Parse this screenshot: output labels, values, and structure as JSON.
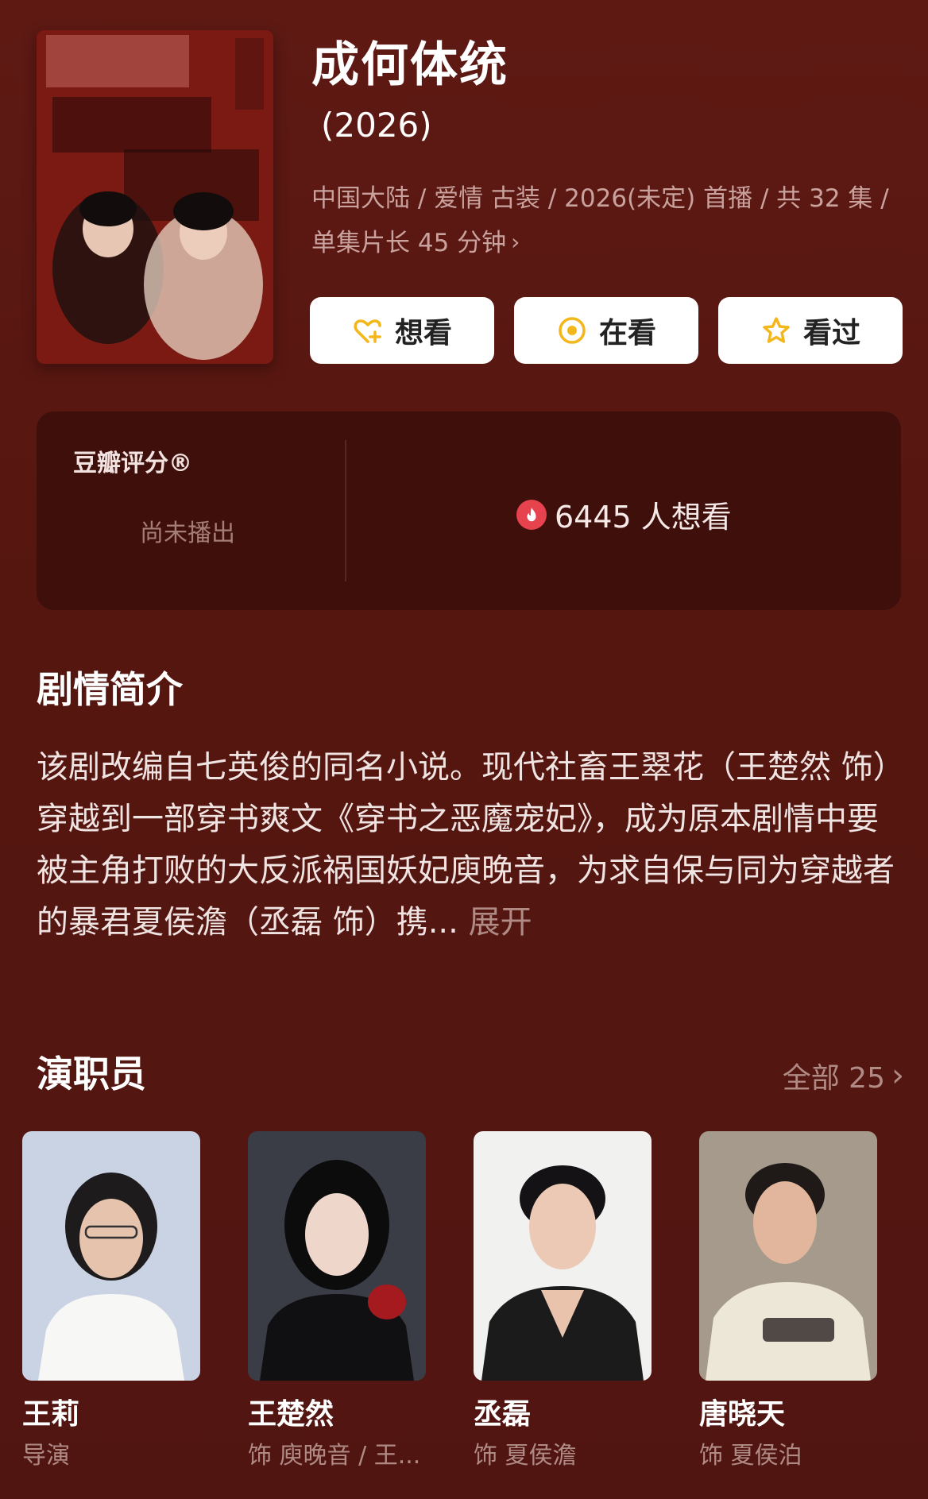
{
  "header": {
    "title": "成何体统",
    "year": "(2026)",
    "meta_line1": "中国大陆 / 爱情 古装 / 2026(未定) 首播 / 共 32 集 /",
    "meta_line2": "单集片长 45 分钟",
    "meta_chevron": "›"
  },
  "actions": [
    {
      "label": "想看",
      "icon": "heart-plus-icon",
      "color": "#f3b71c"
    },
    {
      "label": "在看",
      "icon": "target-icon",
      "color": "#f3b71c"
    },
    {
      "label": "看过",
      "icon": "star-icon",
      "color": "#f3b71c"
    }
  ],
  "rating": {
    "label": "豆瓣评分®",
    "status": "尚未播出",
    "want_count": "6445 人想看"
  },
  "synopsis": {
    "title": "剧情简介",
    "text": "该剧改编自七英俊的同名小说。现代社畜王翠花（王楚然 饰）穿越到一部穿书爽文《穿书之恶魔宠妃》，成为原本剧情中要被主角打败的大反派祸国妖妃庾晚音，为求自保与同为穿越者的暴君夏侯澹（丞磊 饰）携...",
    "more": "展开"
  },
  "cast": {
    "title": "演职员",
    "all_label": "全部 25",
    "all_chevron": "›",
    "members": [
      {
        "name": "王莉",
        "role": "导演"
      },
      {
        "name": "王楚然",
        "role": "饰 庾晚音 / 王..."
      },
      {
        "name": "丞磊",
        "role": "饰 夏侯澹"
      },
      {
        "name": "唐晓天",
        "role": "饰 夏侯泊"
      }
    ]
  },
  "colors": {
    "background": "#5a1812",
    "card": "#3f0f0b",
    "accent": "#f3b71c",
    "muted_text": "#b08b86",
    "flame": "#e7434e"
  }
}
